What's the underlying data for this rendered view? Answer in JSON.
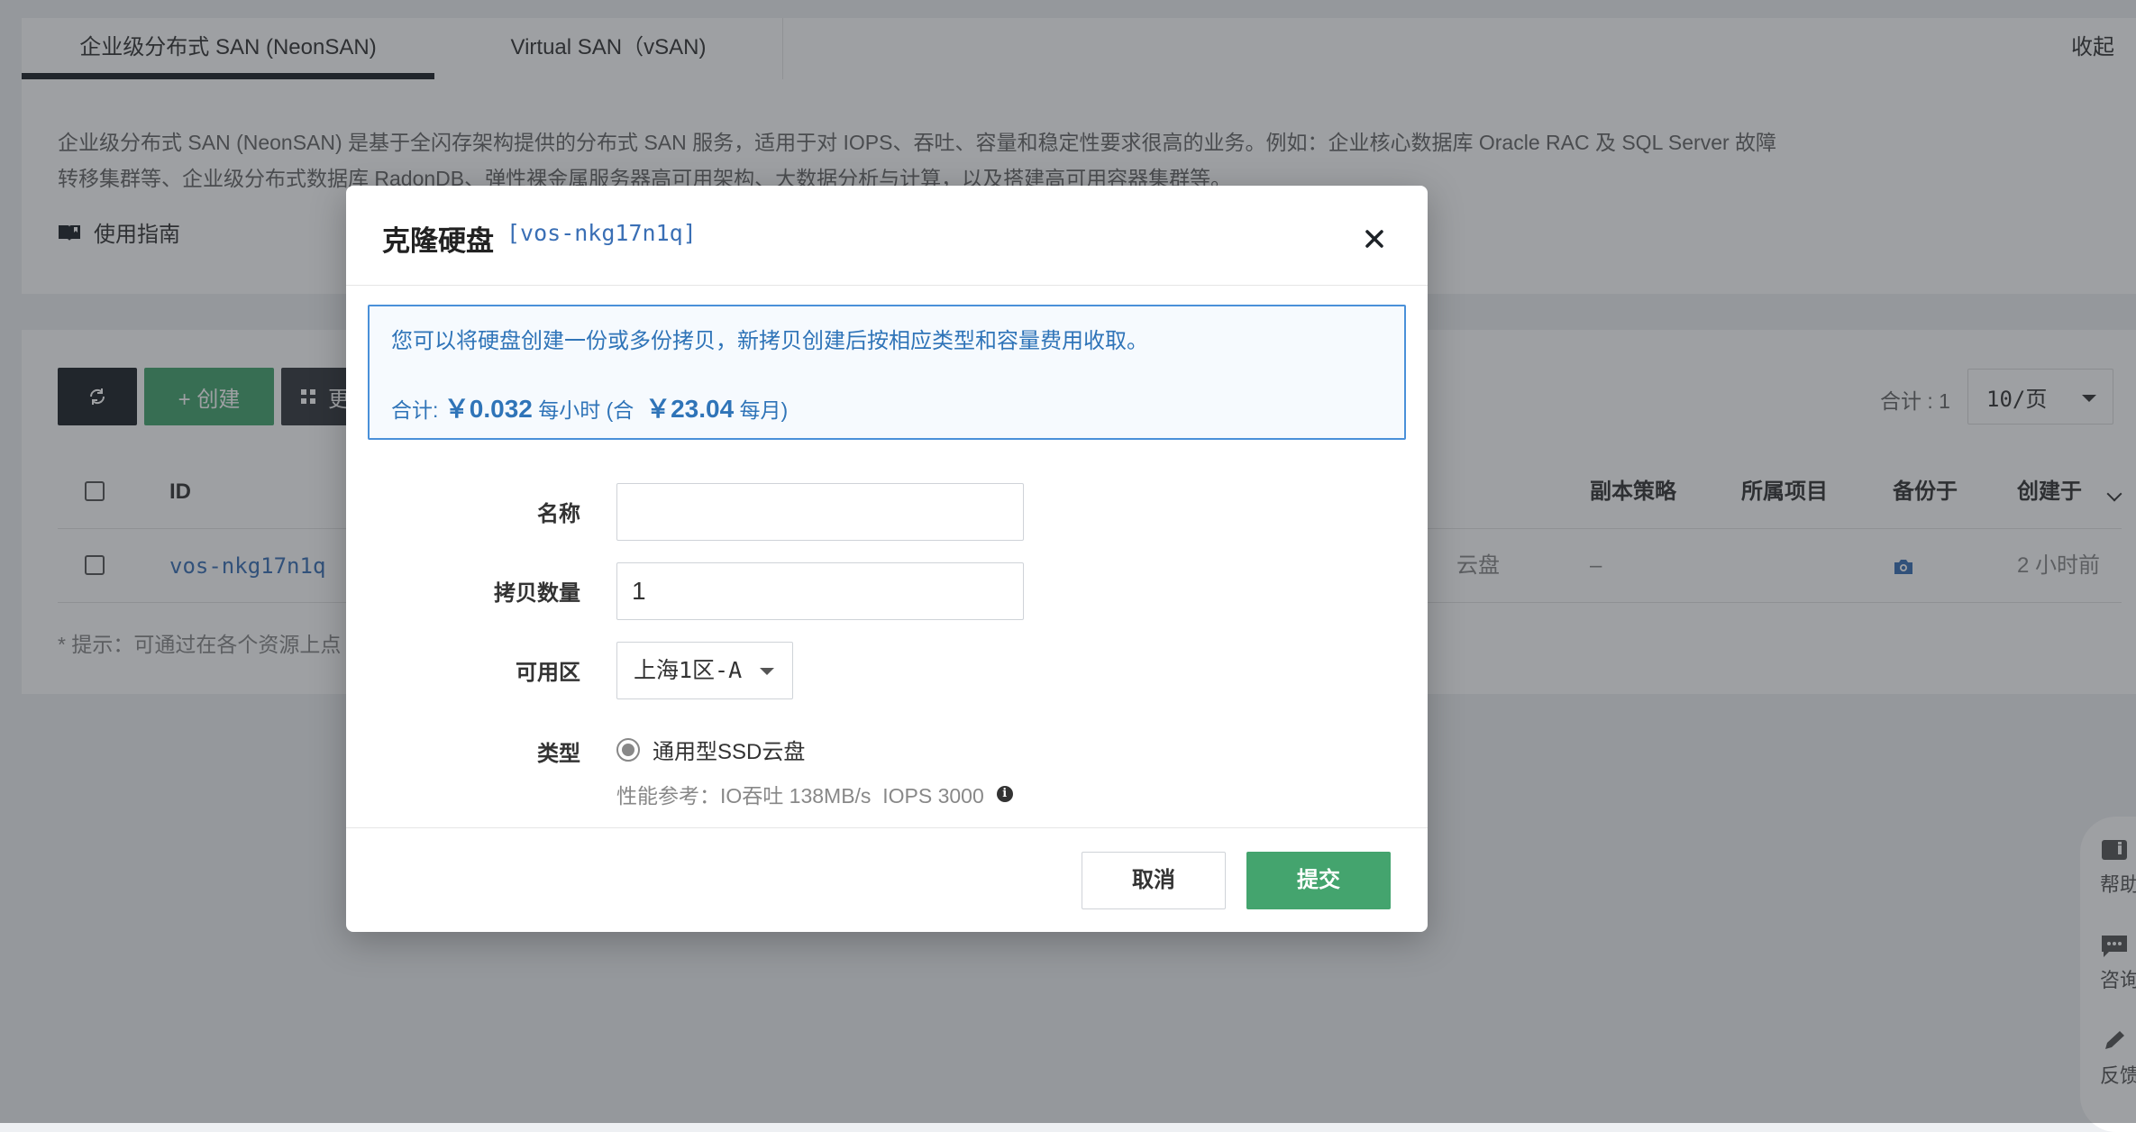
{
  "tabs": {
    "items": [
      {
        "label": "企业级分布式 SAN (NeonSAN)"
      },
      {
        "label": "Virtual SAN（vSAN)"
      }
    ],
    "collapse_label": "收起"
  },
  "description": {
    "text": "企业级分布式 SAN (NeonSAN) 是基于全闪存架构提供的分布式 SAN 服务，适用于对 IOPS、吞吐、容量和稳定性要求很高的业务。例如：企业核心数据库 Oracle RAC 及 SQL Server 故障转移集群等、企业级分布式数据库 RadonDB、弹性裸金属服务器高可用架构、大数据分析与计算，以及搭建高可用容器集群等。",
    "guide_label": "使用指南"
  },
  "toolbar": {
    "create_label": "+ 创建",
    "more_label": "更",
    "total_label": "合计 : 1",
    "page_size": "10/页"
  },
  "table": {
    "headers": {
      "id": "ID",
      "replica": "副本策略",
      "project": "所属项目",
      "backup": "备份于",
      "created": "创建于"
    },
    "rows": [
      {
        "id": "vos-nkg17n1q",
        "type_fragment": "云盘",
        "replica": "–",
        "created": "2 小时前"
      }
    ],
    "tip": "* 提示：可通过在各个资源上点"
  },
  "side_float": {
    "items": [
      {
        "label": "帮助"
      },
      {
        "label": "咨询"
      },
      {
        "label": "反馈"
      }
    ]
  },
  "modal": {
    "title": "克隆硬盘",
    "resource_id": "[vos-nkg17n1q]",
    "info_text": "您可以将硬盘创建一份或多份拷贝，新拷贝创建后按相应类型和容量费用收取。",
    "price": {
      "prefix": "合计: ",
      "hourly": "￥0.032",
      "hourly_unit": " 每小时 (合  ",
      "monthly": "￥23.04",
      "monthly_unit": " 每月)"
    },
    "fields": {
      "name_label": "名称",
      "name_value": "",
      "copies_label": "拷贝数量",
      "copies_value": "1",
      "zone_label": "可用区",
      "zone_value": "上海1区-A",
      "type_label": "类型",
      "type_option": "通用型SSD云盘",
      "performance": "性能参考：IO吞吐 138MB/s  IOPS 3000"
    },
    "cancel_label": "取消",
    "submit_label": "提交"
  },
  "colors": {
    "primary_green": "#44a46e",
    "dark": "#1d2227",
    "link_blue": "#3a6fb5",
    "info_blue": "#2f74b8"
  }
}
